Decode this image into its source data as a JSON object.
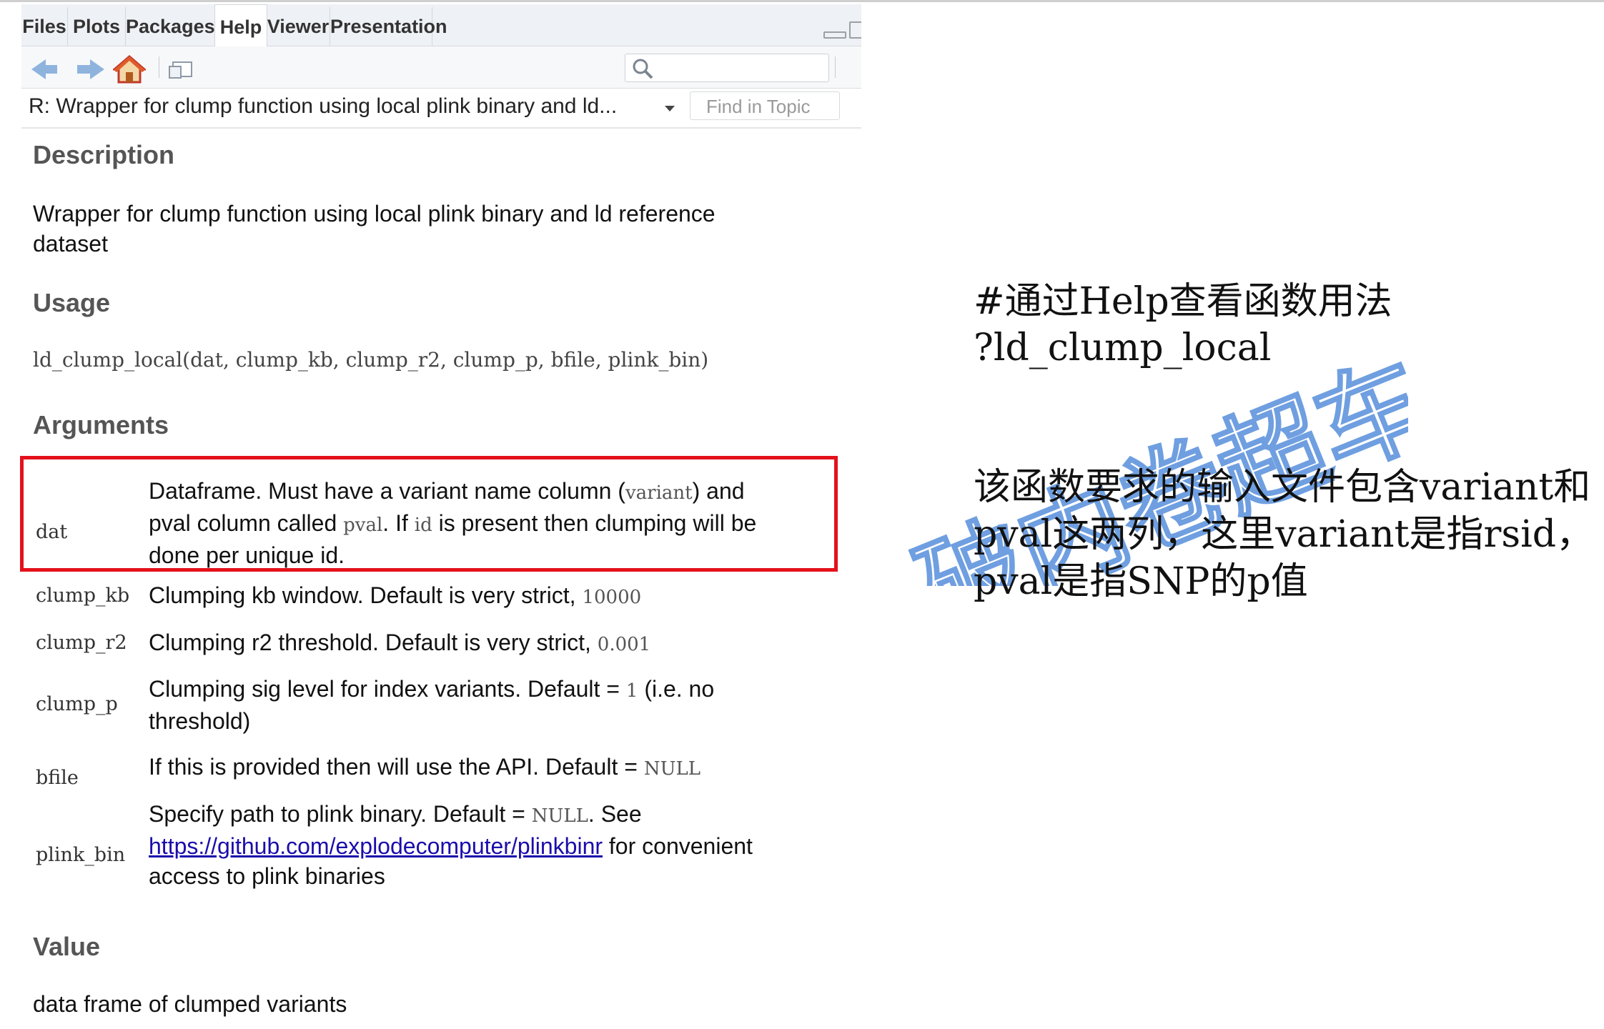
{
  "tabs": [
    {
      "label": "Files",
      "active": false
    },
    {
      "label": "Plots",
      "active": false
    },
    {
      "label": "Packages",
      "active": false
    },
    {
      "label": "Help",
      "active": true
    },
    {
      "label": "Viewer",
      "active": false
    },
    {
      "label": "Presentation",
      "active": false
    }
  ],
  "toolbar": {
    "icons": [
      "back-arrow-icon",
      "forward-arrow-icon",
      "home-icon",
      "popout-icon",
      "search-icon"
    ],
    "search_value": ""
  },
  "topic": {
    "title": "R: Wrapper for clump function using local plink binary and ld...",
    "find_placeholder": "Find in Topic"
  },
  "help": {
    "description_heading": "Description",
    "description_text_1": "Wrapper for clump function using local plink binary and ld reference",
    "description_text_2": "dataset",
    "usage_heading": "Usage",
    "usage_code": "ld_clump_local(dat,  clump_kb,  clump_r2,  clump_p,  bfile,  plink_bin)",
    "arguments_heading": "Arguments",
    "args": [
      {
        "name": "dat",
        "l1_a": "Dataframe. Must have a variant name column (",
        "l1_code": "variant",
        "l1_b": ") and",
        "l2_a": "pval column called ",
        "l2_code1": "pval",
        "l2_b": ". If ",
        "l2_code2": "id",
        "l2_c": " is present then clumping will be",
        "l3": "done per unique id."
      },
      {
        "name": "clump_kb",
        "text": "Clumping kb window. Default is very strict, ",
        "code": "10000"
      },
      {
        "name": "clump_r2",
        "text": "Clumping r2 threshold. Default is very strict, ",
        "code": "0.001"
      },
      {
        "name": "clump_p",
        "l1_a": "Clumping sig level for index variants. Default = ",
        "l1_code": "1",
        "l1_b": " (i.e. no",
        "l2": "threshold)"
      },
      {
        "name": "bfile",
        "text": "If this is provided then will use the API. Default = ",
        "code": "NULL"
      },
      {
        "name": "plink_bin",
        "l1_a": "Specify path to plink binary. Default = ",
        "l1_code": "NULL",
        "l1_b": ". See",
        "link": "https://github.com/explodecomputer/plinkbinr",
        "l2_b": " for convenient",
        "l3": "access to plink binaries"
      }
    ],
    "value_heading": "Value",
    "value_text": "data frame of clumped variants"
  },
  "annotation": {
    "line1": "#通过Help查看函数用法",
    "line2": "?ld_clump_local",
    "line3": "该函数要求的输入文件包含variant和",
    "line4": "pval这两列，这里variant是指rsid，",
    "line5": "pval是指SNP的p值"
  },
  "watermark": {
    "text": "破内卷超车",
    "color": "#3f7fd6"
  },
  "colors": {
    "highlight_box": "#e4111b",
    "link": "#1a0dab"
  }
}
